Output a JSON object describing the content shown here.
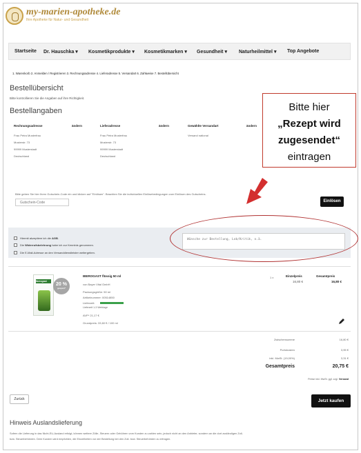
{
  "logo": {
    "title": "my-marien-apotheke.de",
    "subtitle": "Ihre Apotheke für Natur- und Gesundheit"
  },
  "nav": [
    {
      "label": "Startseite"
    },
    {
      "label": "Dr. Hauschka ▾"
    },
    {
      "label": "Kosmetikprodukte ▾"
    },
    {
      "label": "Kosmetikmarken ▾"
    },
    {
      "label": "Gesundheit ▾"
    },
    {
      "label": "Naturheilmittel ▾"
    },
    {
      "label": "Top Angebote"
    }
  ],
  "steps": "1. Warenkorb   2. Anmelden / Registrieren   3. Rechnungsadresse   4. Lieferadresse   5. Versandart   6. Zahlweise   7. Bestellübersicht",
  "overview": {
    "title": "Bestellübersicht",
    "subtitle": "Bitte kontrollieren Sie die Angaben auf ihre Richtigkeit.",
    "details_title": "Bestellangaben"
  },
  "billing": {
    "heading": "Rechnungsadresse",
    "edit": "ändern",
    "lines": [
      "Frau Petra Musterfrau",
      "Musterstr. 73",
      "99999 Musterstadt",
      "Deutschland"
    ]
  },
  "shipping": {
    "heading": "Lieferadresse",
    "edit": "ändern",
    "lines": [
      "Frau Petra Musterfrau",
      "Musterstr. 73",
      "99999 Musterstadt",
      "Deutschland"
    ]
  },
  "method": {
    "heading": "Gewählte Versandart",
    "edit": "ändern",
    "value": "Versand national"
  },
  "callout": {
    "line1": "Bitte hier",
    "line2": "„Rezept wird",
    "line3": "zugesendet“",
    "line4": "eintragen"
  },
  "voucher": {
    "text": "Bitte geben Sie hier Ihren Gutschein-Code ein und klicken auf \"Einlösen\". Beachten Sie die individuellen Einlösebedingungen zum Einlösen des Gutscheins.",
    "placeholder": "Gutschein-Code",
    "button": "Einlösen"
  },
  "checks": [
    {
      "pre": "Hiermit akzeptiere ich die ",
      "bold": "AGB",
      "post": "."
    },
    {
      "pre": "Die ",
      "bold": "Widerrufsbelehrung",
      "post": " habe ich zur Kenntnis genommen."
    },
    {
      "pre": "Die E-Mail-Adresse an den Versanddienstleister weitergeben.",
      "bold": "",
      "post": ""
    }
  ],
  "comment": {
    "placeholder": "Wünsche zur Bestellung, Lob/Kritik, o.ä."
  },
  "product": {
    "name": "IBEROGAST flüssig 50 ml",
    "maker": "von Bayer Vital GmbH",
    "package": "Packungsgröße: 50 ml",
    "article": "Artikelnummer: 00514850",
    "delivery": "Lieferzeit:",
    "delivery_note": "Lieferzeit 1-3 Werktage",
    "avp": "AVP* 21,17 €",
    "base_price": "Grundpreis: 33,60 € / 100 ml",
    "qty": "1 x",
    "unit_label": "Einzelpreis",
    "unit_price": "16,80 €",
    "total_label": "Gesamtpreis",
    "total_price": "16,80 €",
    "discount_badge": "20 %",
    "discount_sub": "gespart*",
    "img_label": "Iberogast"
  },
  "totals": [
    {
      "label": "Zwischensumme",
      "value": "16,80 €"
    },
    {
      "label": "Portokosten",
      "value": "3,95 €"
    },
    {
      "label": "inkl. MwSt. (19,00%)",
      "value": "3,31 €"
    }
  ],
  "grand": {
    "label": "Gesamtpreis",
    "value": "20,75 €"
  },
  "tax_note": {
    "text": "Preise inkl. MwSt. ggf. zzgl. ",
    "link": "Versand"
  },
  "back": "Zurück",
  "buy": "Jetzt kaufen",
  "notice": {
    "title": "Hinweis Auslandslieferung",
    "text1": "Sofern die Lieferung in das Nicht-EU-Ausland erfolgt, können weitere Zölle, Steuern oder Gebühren vom Kunden zu zahlen sein, jedoch nicht an den Anbieter, sondern an die dort zuständigen Zoll-",
    "text2": "bzw. Steuerbehörden. Dem Kunden wird empfohlen, die Einzelheiten vor der Bestellung bei den Zoll- bzw. Steuerbehörden zu erfragen."
  },
  "colors": {
    "callout_border": "#c0392b",
    "arrow": "#d32f2f",
    "ellipse": "#b03030",
    "button": "#111111",
    "progress": "#3aa04a"
  }
}
